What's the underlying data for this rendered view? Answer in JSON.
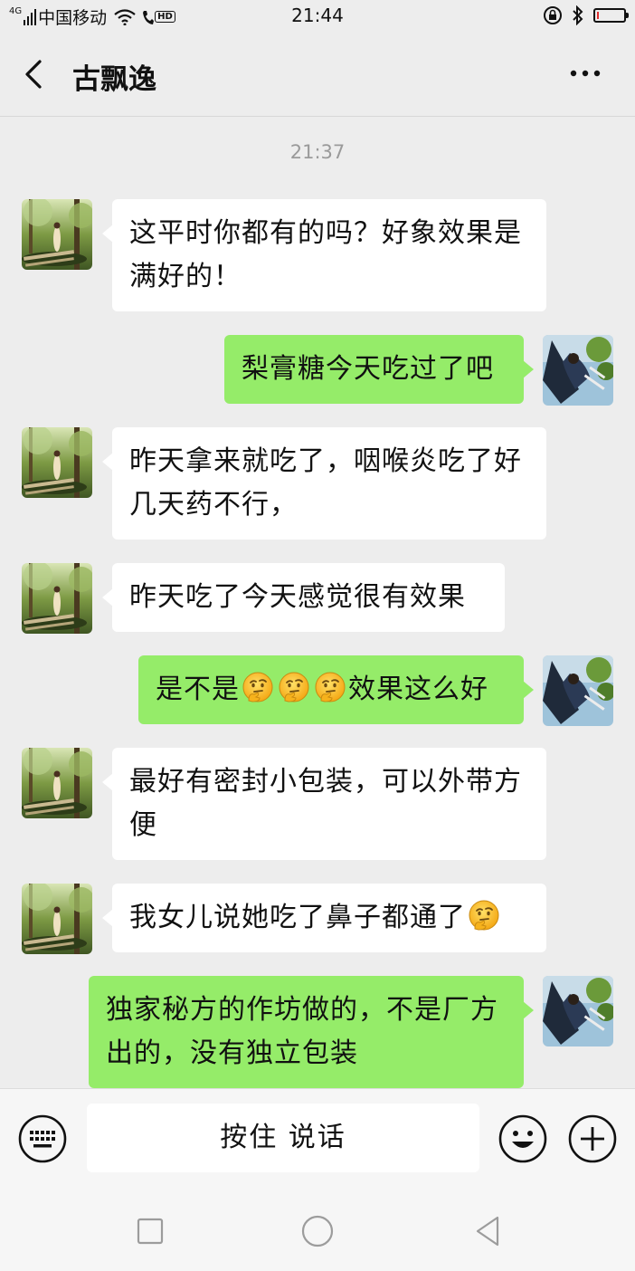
{
  "status_bar": {
    "network_badge": "4G",
    "carrier": "中国移动",
    "hd_badge": "HD",
    "time": "21:44",
    "battery_level": 0.08,
    "battery_color": "#e03030"
  },
  "header": {
    "back_icon": "chevron-left-icon",
    "title": "古飘逸",
    "more_icon": "more-dots-icon"
  },
  "chat": {
    "timestamp": "21:37",
    "messages": [
      {
        "direction": "in",
        "text": "这平时你都有的吗？好象效果是满好的！"
      },
      {
        "direction": "out",
        "text": "梨膏糖今天吃过了吧"
      },
      {
        "direction": "in",
        "text": "昨天拿来就吃了，咽喉炎吃了好几天药不行，"
      },
      {
        "direction": "in",
        "text": "昨天吃了今天感觉很有效果"
      },
      {
        "direction": "out",
        "text_before": "是不是",
        "emojis": [
          "thinking-face-icon",
          "thinking-face-icon",
          "thinking-face-icon"
        ],
        "text_after": "效果这么好"
      },
      {
        "direction": "in",
        "text": "最好有密封小包装，可以外带方便"
      },
      {
        "direction": "in",
        "text_before": "我女儿说她吃了鼻子都通了",
        "emojis": [
          "thinking-face-icon"
        ]
      },
      {
        "direction": "out",
        "text": "独家秘方的作坊做的，不是厂方出的，没有独立包装"
      }
    ]
  },
  "input_bar": {
    "keyboard_icon": "keyboard-icon",
    "hold_to_talk": "按住 说话",
    "emoji_icon": "smiley-icon",
    "plus_icon": "plus-icon"
  },
  "colors": {
    "background": "#ededed",
    "incoming_bubble": "#ffffff",
    "outgoing_bubble": "#95ec69"
  }
}
